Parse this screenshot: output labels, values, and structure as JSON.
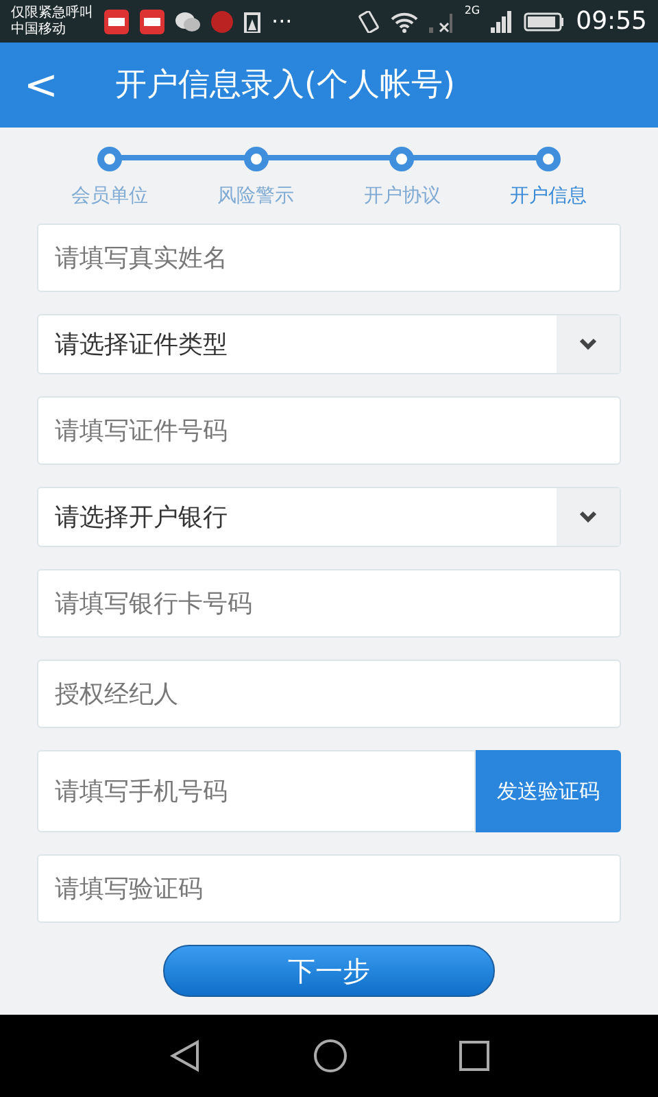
{
  "status_bar": {
    "carrier_top": "仅限紧急呼叫",
    "carrier_bottom": "中国移动",
    "more": "···",
    "network": "2G",
    "time": "09:55"
  },
  "header": {
    "back": "<",
    "title": "开户信息录入(个人帐号)"
  },
  "steps": [
    {
      "label": "会员单位",
      "selected": false
    },
    {
      "label": "风险警示",
      "selected": false
    },
    {
      "label": "开户协议",
      "selected": false
    },
    {
      "label": "开户信息",
      "selected": true
    }
  ],
  "fields": [
    {
      "kind": "input",
      "placeholder": "请填写真实姓名"
    },
    {
      "kind": "select",
      "value": "请选择证件类型"
    },
    {
      "kind": "input",
      "placeholder": "请填写证件号码"
    },
    {
      "kind": "select",
      "value": "请选择开户银行"
    },
    {
      "kind": "input",
      "placeholder": "请填写银行卡号码"
    },
    {
      "kind": "input",
      "placeholder": "授权经纪人"
    },
    {
      "kind": "button_input",
      "placeholder": "请填写手机号码",
      "button": "发送验证码"
    },
    {
      "kind": "input",
      "placeholder": "请填写验证码"
    }
  ],
  "next_button": "下一步"
}
